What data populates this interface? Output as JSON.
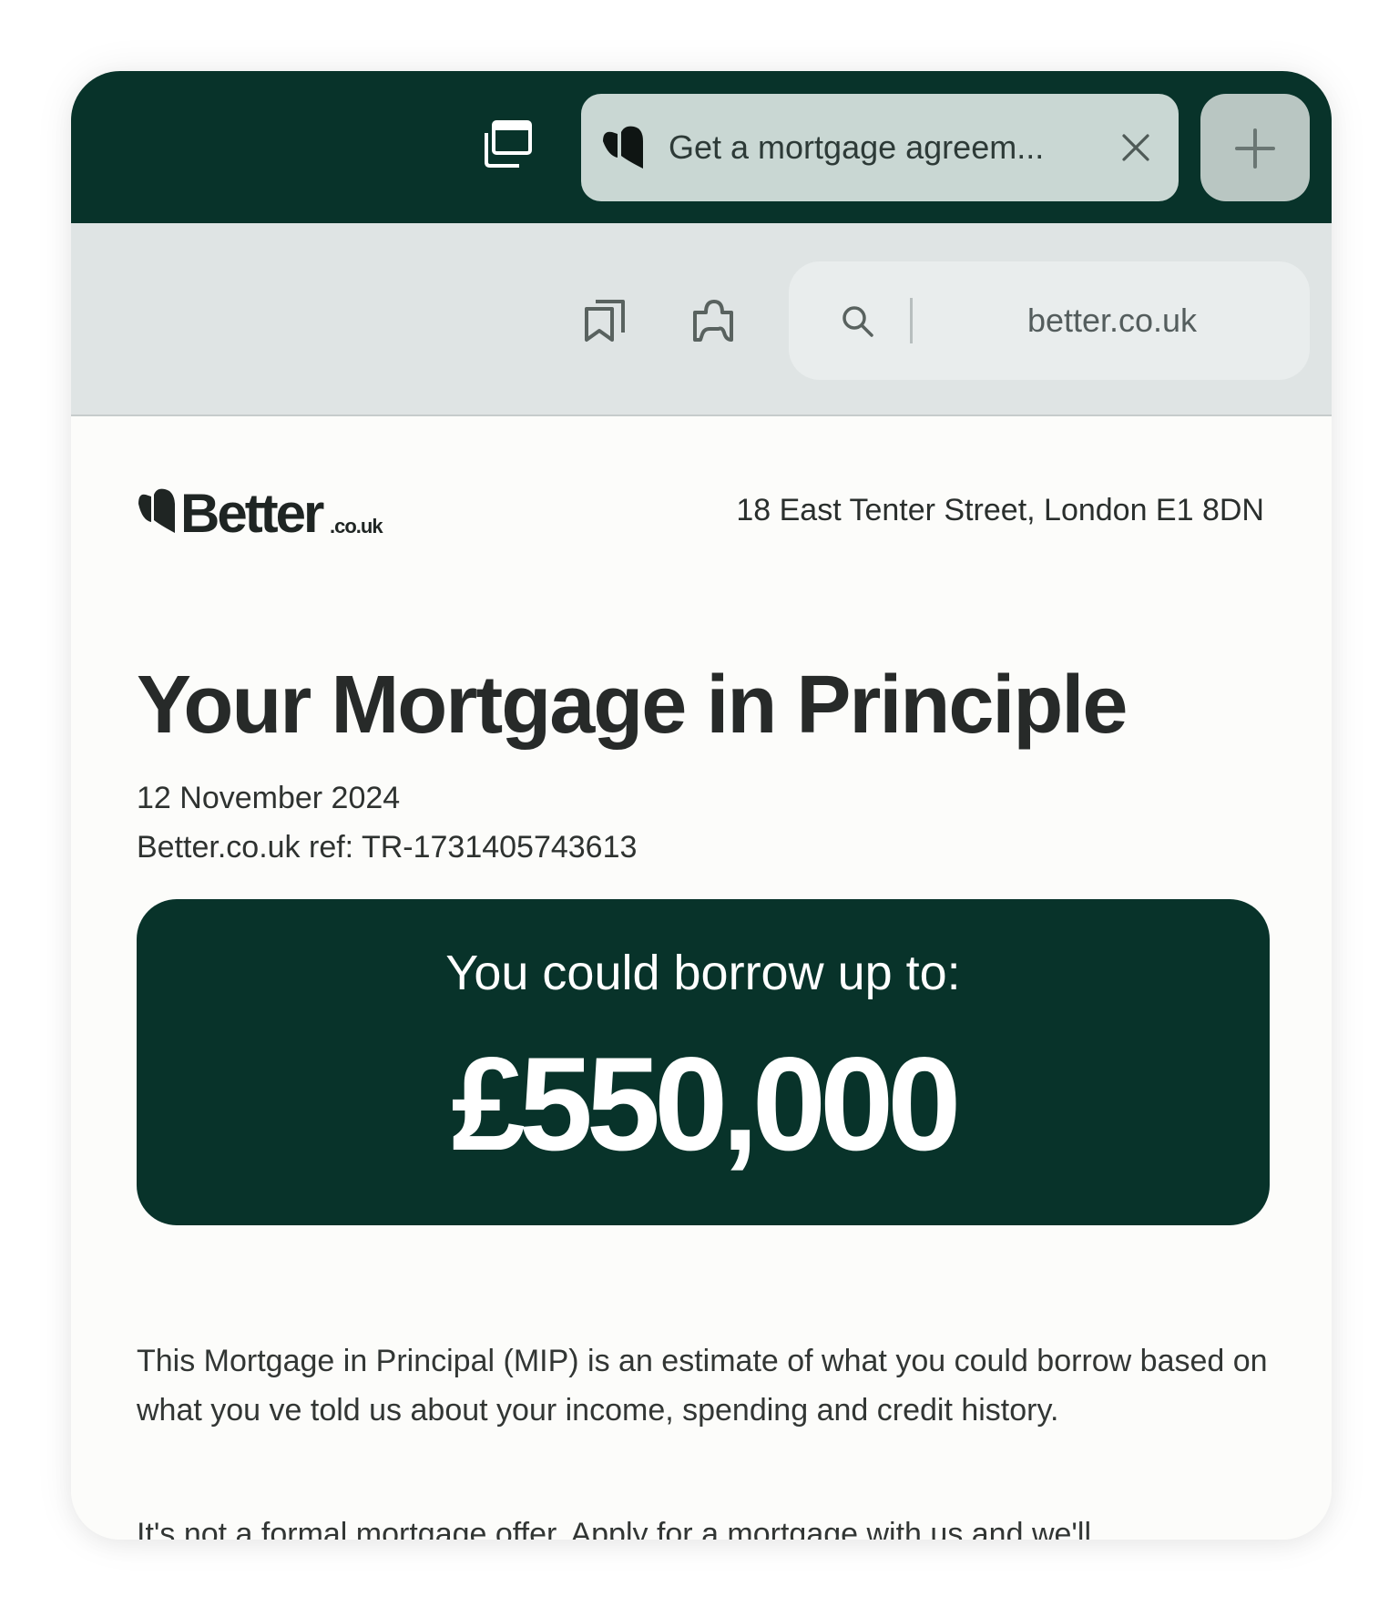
{
  "browser": {
    "tab": {
      "title": "Get a mortgage agreem..."
    },
    "url_bar": {
      "url": "better.co.uk"
    },
    "icons": [
      "tabs-overview-icon",
      "better-favicon-icon",
      "close-icon",
      "plus-icon",
      "bookmark-icon",
      "extension-icon",
      "search-icon"
    ],
    "colors": {
      "tab_bar": "#08332a",
      "active_tab": "#c9d7d3",
      "toolbar": "#dfe4e4"
    }
  },
  "page": {
    "logo": {
      "word": "Better",
      "suffix": ".co.uk"
    },
    "address": "18 East Tenter Street, London E1 8DN",
    "title": "Your Mortgage in Principle",
    "date": "12 November 2024",
    "reference": "Better.co.uk ref: TR-1731405743613",
    "borrow": {
      "label": "You could borrow up to:",
      "amount": "£550,000",
      "background": "#08332a"
    },
    "paragraphs": [
      "This Mortgage in Principal (MIP) is an estimate of what you could borrow based on what you ve told us about your income, spending and credit history.",
      "It's not a formal mortgage offer. Apply for a mortgage with us and we'll"
    ]
  }
}
